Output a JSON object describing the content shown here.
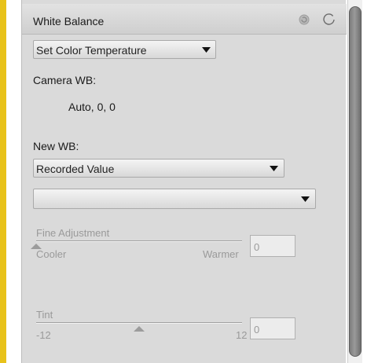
{
  "colors": {
    "accent": "#e8c21a",
    "panel_bg": "#dadada",
    "disabled_text": "#9a9a9a"
  },
  "panel": {
    "title": "White Balance",
    "reset_icon": "reset-icon",
    "toggle_icon": "toggle-icon"
  },
  "mode_select": {
    "value": "Set Color Temperature"
  },
  "camera_wb": {
    "label": "Camera WB:",
    "value": "Auto, 0, 0"
  },
  "new_wb": {
    "label": "New WB:",
    "preset_select": "Recorded Value",
    "secondary_select": ""
  },
  "fine_adjustment": {
    "label": "Fine Adjustment",
    "min_label": "Cooler",
    "max_label": "Warmer",
    "value": "0",
    "level": 0
  },
  "tint": {
    "label": "Tint",
    "min_label": "-12",
    "max_label": "12",
    "value": "0",
    "level": 0.5
  }
}
